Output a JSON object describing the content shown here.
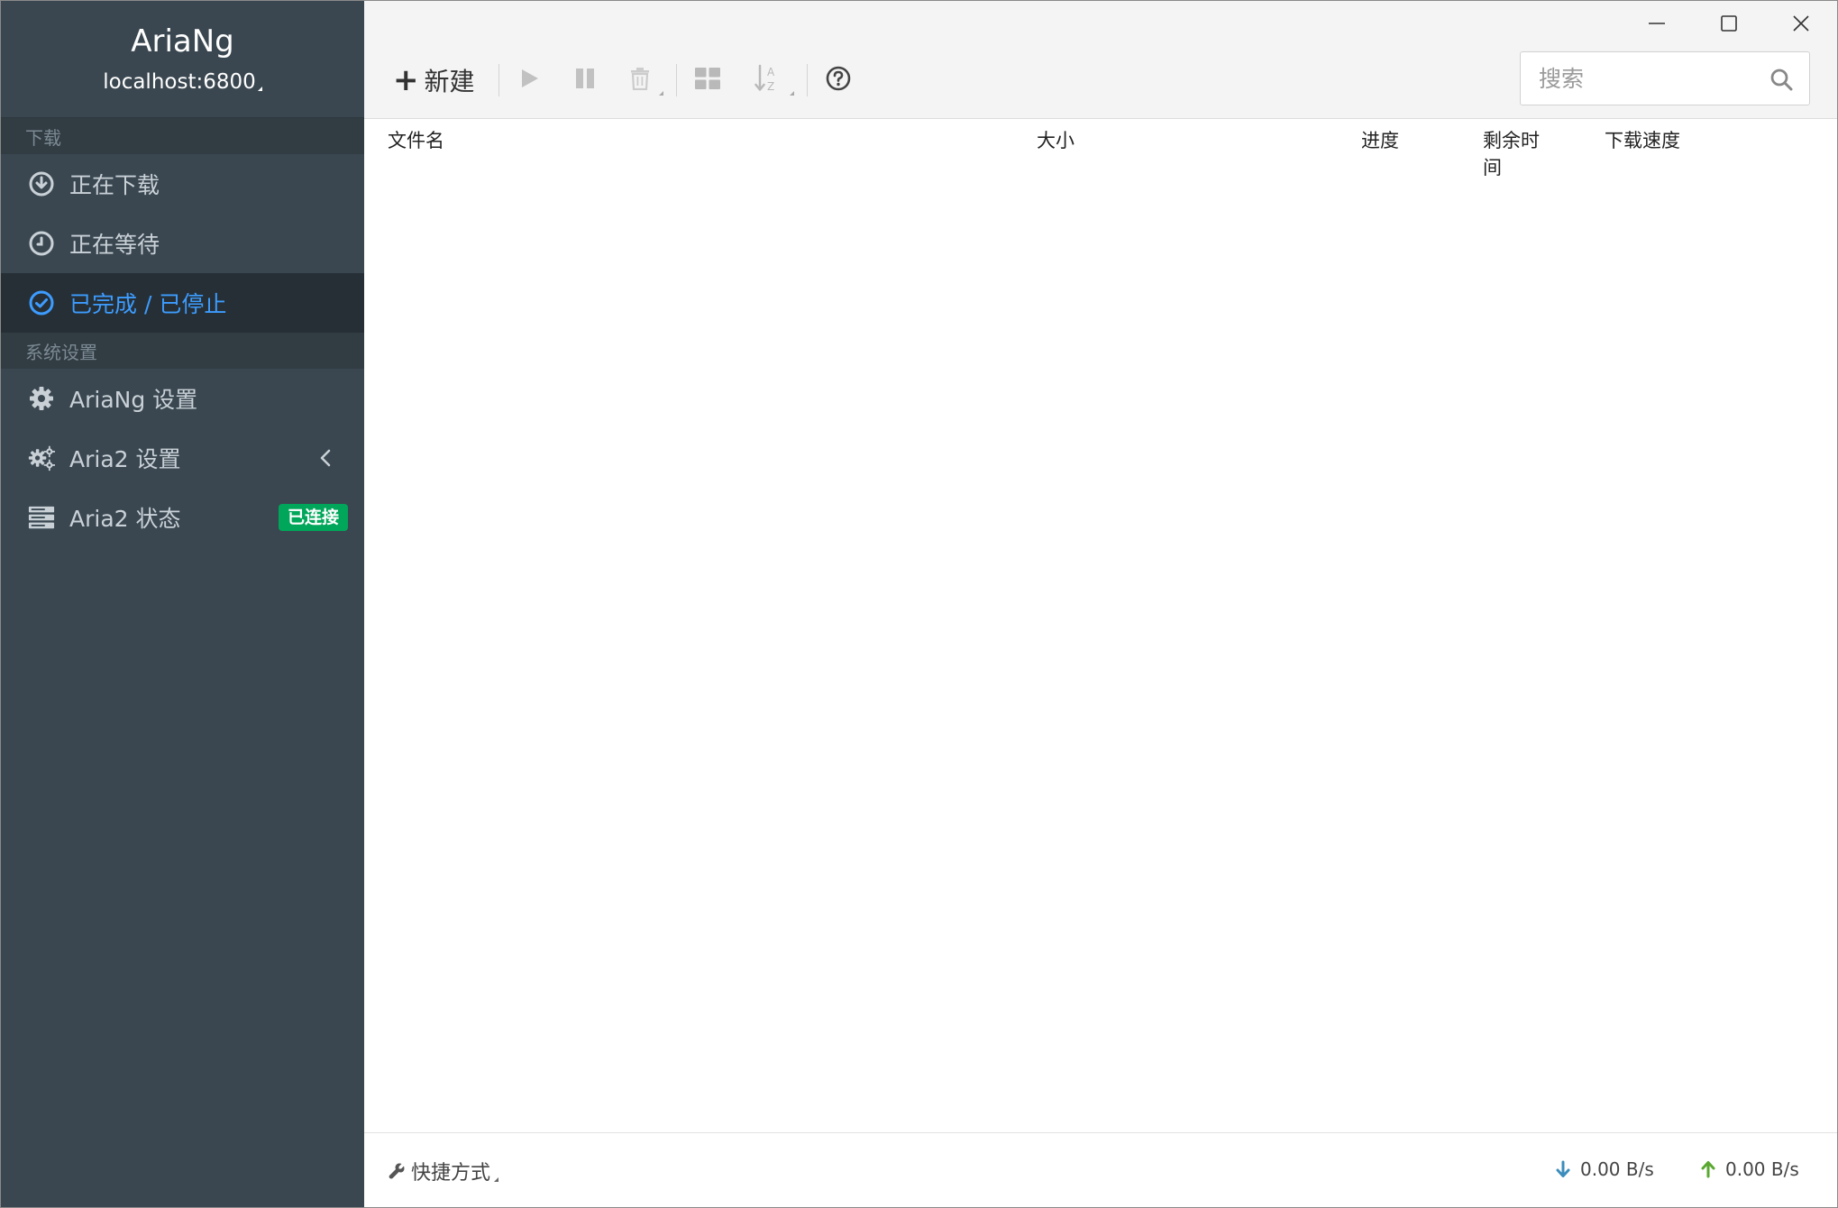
{
  "brand": {
    "title": "AriaNg",
    "host": "localhost:6800"
  },
  "sidebar": {
    "sections": [
      {
        "header": "下载",
        "items": [
          {
            "label": "正在下载",
            "icon": "download-circle-icon"
          },
          {
            "label": "正在等待",
            "icon": "clock-icon"
          },
          {
            "label": "已完成 / 已停止",
            "icon": "check-circle-icon",
            "active": true
          }
        ]
      },
      {
        "header": "系统设置",
        "items": [
          {
            "label": "AriaNg 设置",
            "icon": "gear-icon"
          },
          {
            "label": "Aria2 设置",
            "icon": "gears-icon"
          },
          {
            "label": "Aria2 状态",
            "icon": "server-icon",
            "badge": "已连接"
          }
        ]
      }
    ]
  },
  "toolbar": {
    "new_label": "新建",
    "search_placeholder": "搜索"
  },
  "table": {
    "columns": [
      "文件名",
      "大小",
      "进度",
      "剩余时间",
      "下载速度"
    ]
  },
  "footer": {
    "shortcut_label": "快捷方式",
    "download_speed": "0.00 B/s",
    "upload_speed": "0.00 B/s"
  },
  "colors": {
    "sidebar_bg": "#3a4750",
    "active_bg": "#262f35",
    "accent": "#3d9cff",
    "badge_green": "#00a65a",
    "download_arrow": "#3c8dbc",
    "upload_arrow": "#5aa832"
  }
}
